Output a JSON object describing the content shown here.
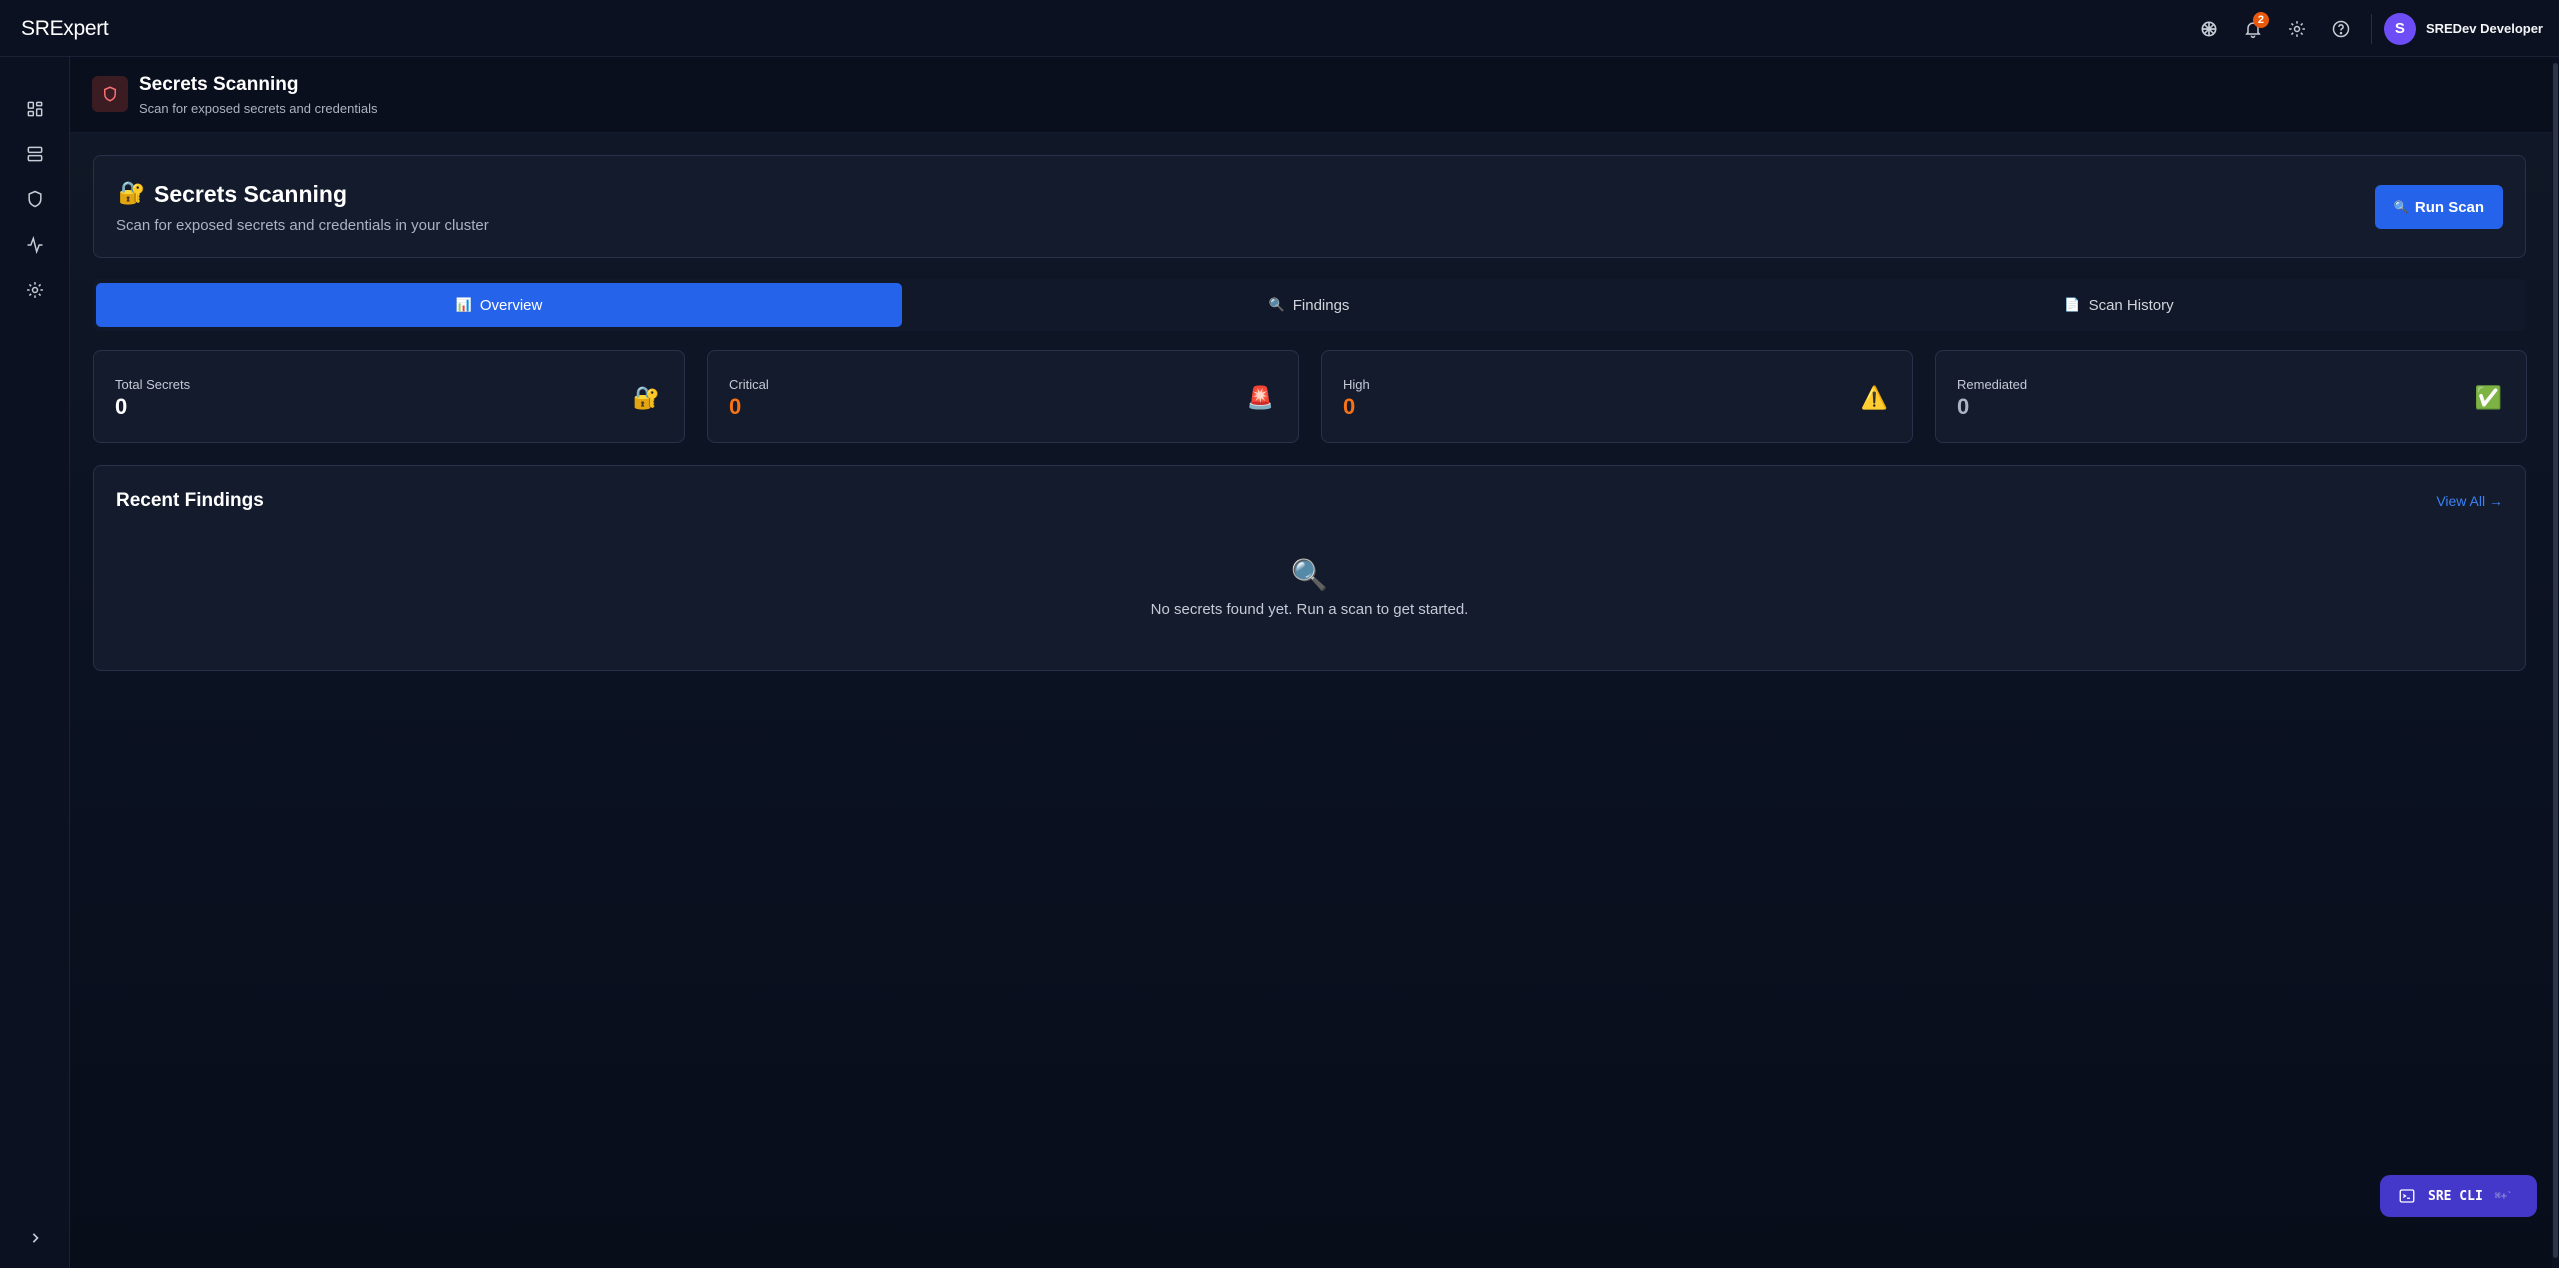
{
  "app": {
    "brand": "SRExpert"
  },
  "topbar": {
    "notifications_count": "2",
    "user": {
      "initial": "S",
      "name": "SREDev Developer"
    }
  },
  "page_header": {
    "title": "Secrets Scanning",
    "subtitle": "Scan for exposed secrets and credentials"
  },
  "hero": {
    "emoji": "🔐",
    "title": "Secrets Scanning",
    "subtitle": "Scan for exposed secrets and credentials in your cluster",
    "run_button_icon": "🔍",
    "run_button_label": "Run Scan"
  },
  "tabs": [
    {
      "icon": "📊",
      "label": "Overview",
      "active": true
    },
    {
      "icon": "🔍",
      "label": "Findings",
      "active": false
    },
    {
      "icon": "📄",
      "label": "Scan History",
      "active": false
    }
  ],
  "stats": [
    {
      "label": "Total Secrets",
      "value": "0",
      "icon": "🔐"
    },
    {
      "label": "Critical",
      "value": "0",
      "icon": "🚨"
    },
    {
      "label": "High",
      "value": "0",
      "icon": "⚠️"
    },
    {
      "label": "Remediated",
      "value": "0",
      "icon": "✅"
    }
  ],
  "recent_findings": {
    "title": "Recent Findings",
    "view_all": "View All →",
    "empty_icon": "🔍",
    "empty_text": "No secrets found yet. Run a scan to get started."
  },
  "cli": {
    "label": "SRE CLI",
    "shortcut": "⌘+`"
  },
  "colors": {
    "accent": "#2563eb",
    "orange": "#f97316",
    "background": "#0b1120",
    "card": "#131b2c"
  }
}
